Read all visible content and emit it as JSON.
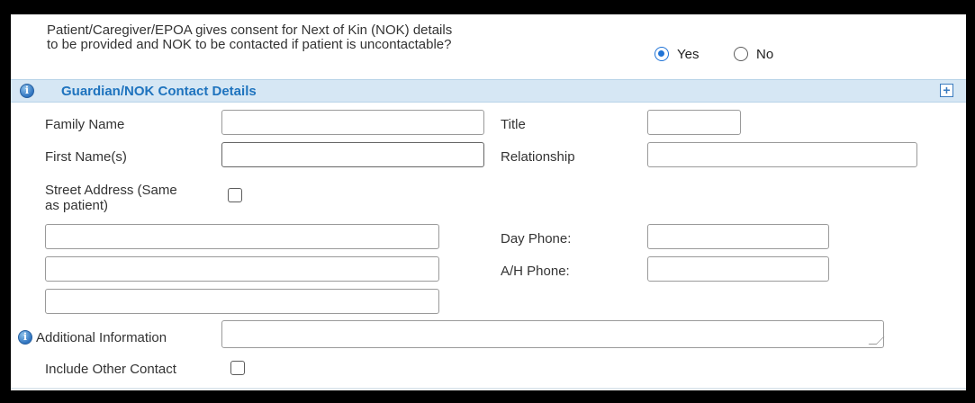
{
  "consent": {
    "question_line1": "Patient/Caregiver/EPOA gives consent for Next of Kin (NOK) details",
    "question_line2": "to be provided and NOK to be contacted if patient is uncontactable?",
    "yes_label": "Yes",
    "no_label": "No",
    "selected": "Yes"
  },
  "section": {
    "title": "Guardian/NOK Contact Details",
    "info_icon": "info-icon",
    "expand_icon": "plus-square-icon"
  },
  "fields": {
    "family_name_label": "Family Name",
    "family_name_value": "",
    "title_label": "Title",
    "title_value": "",
    "first_names_label": "First Name(s)",
    "first_names_value": "",
    "relationship_label": "Relationship",
    "relationship_value": "",
    "street_address_label_line1": "Street Address (Same",
    "street_address_label_line2": "as patient)",
    "street_address_same_checked": false,
    "address_line1_value": "",
    "address_line2_value": "",
    "address_line3_value": "",
    "day_phone_label": "Day Phone:",
    "day_phone_value": "",
    "ah_phone_label": "A/H Phone:",
    "ah_phone_value": "",
    "additional_info_label": "Additional Information",
    "additional_info_value": "",
    "include_other_contact_label": "Include Other Contact",
    "include_other_contact_checked": false
  }
}
